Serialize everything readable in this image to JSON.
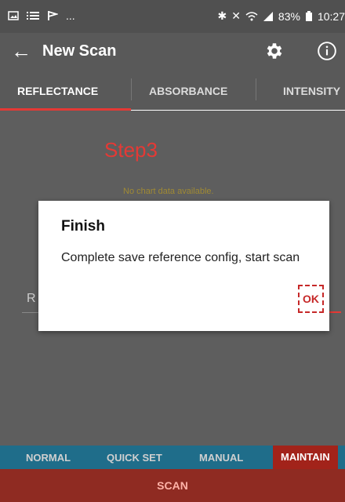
{
  "status_bar": {
    "notif_icons": [
      "image-icon",
      "list-icon",
      "flag-icon"
    ],
    "ellipsis": "...",
    "battery": "83%",
    "time": "10:27"
  },
  "app_bar": {
    "title": "New Scan",
    "back_icon": "arrow-left-icon",
    "settings_icon": "gear-icon",
    "info_icon": "info-icon"
  },
  "tabs": [
    {
      "label": "REFLECTANCE",
      "active": true
    },
    {
      "label": "ABSORBANCE",
      "active": false
    },
    {
      "label": "INTENSITY",
      "active": false
    }
  ],
  "content": {
    "step_label": "Step3",
    "no_data": "No chart data available.",
    "input_label": "R"
  },
  "dialog": {
    "title": "Finish",
    "message": "Complete save reference config, start scan",
    "ok_label": "OK"
  },
  "bottom_tabs": [
    {
      "label": "NORMAL",
      "active": false
    },
    {
      "label": "QUICK SET",
      "active": false
    },
    {
      "label": "MANUAL",
      "active": false
    },
    {
      "label": "MAINTAIN",
      "active": true
    }
  ],
  "scan_button": "SCAN",
  "colors": {
    "accent": "#e53935",
    "bottom_bar": "#1f6d8a",
    "scan_bar": "#8f2b22"
  }
}
